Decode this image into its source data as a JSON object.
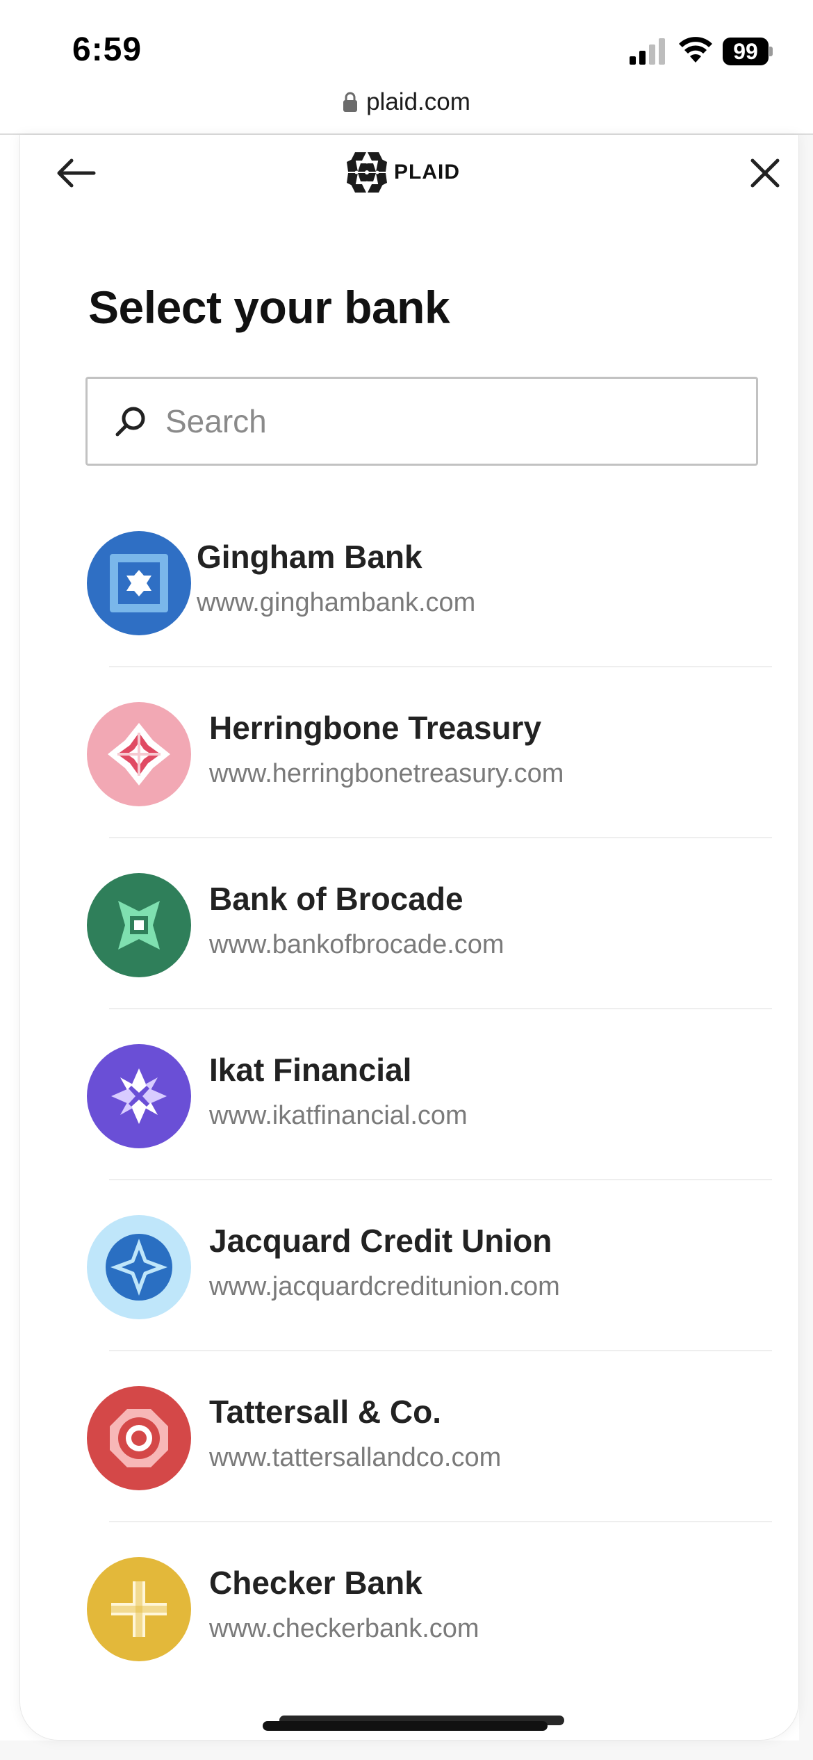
{
  "status_bar": {
    "time": "6:59",
    "battery": "99",
    "icons": [
      "signal-icon",
      "wifi-icon",
      "battery-icon"
    ]
  },
  "browser": {
    "url": "plaid.com",
    "icon": "lock-icon"
  },
  "header": {
    "brand": "PLAID",
    "back_icon": "arrow-left-icon",
    "close_icon": "close-icon",
    "logo_icon": "plaid-logo-icon"
  },
  "title": "Select your bank",
  "search": {
    "placeholder": "Search",
    "value": "",
    "icon": "search-icon"
  },
  "banks": [
    {
      "name": "Gingham Bank",
      "url": "www.ginghambank.com",
      "color": "#2f6fc4",
      "icon": "gingham-bank-logo"
    },
    {
      "name": "Herringbone Treasury",
      "url": "www.herringbonetreasury.com",
      "color": "#f2a8b4",
      "icon": "herringbone-treasury-logo"
    },
    {
      "name": "Bank of Brocade",
      "url": "www.bankofbrocade.com",
      "color": "#2f7f5a",
      "icon": "bank-of-brocade-logo"
    },
    {
      "name": "Ikat Financial",
      "url": "www.ikatfinancial.com",
      "color": "#6a4fd6",
      "icon": "ikat-financial-logo"
    },
    {
      "name": "Jacquard Credit Union",
      "url": "www.jacquardcreditunion.com",
      "color": "#bfe6fa",
      "icon": "jacquard-credit-union-logo"
    },
    {
      "name": "Tattersall & Co.",
      "url": "www.tattersallandco.com",
      "color": "#d44848",
      "icon": "tattersall-logo"
    },
    {
      "name": "Checker Bank",
      "url": "www.checkerbank.com",
      "color": "#e3b83a",
      "icon": "checker-bank-logo"
    }
  ]
}
